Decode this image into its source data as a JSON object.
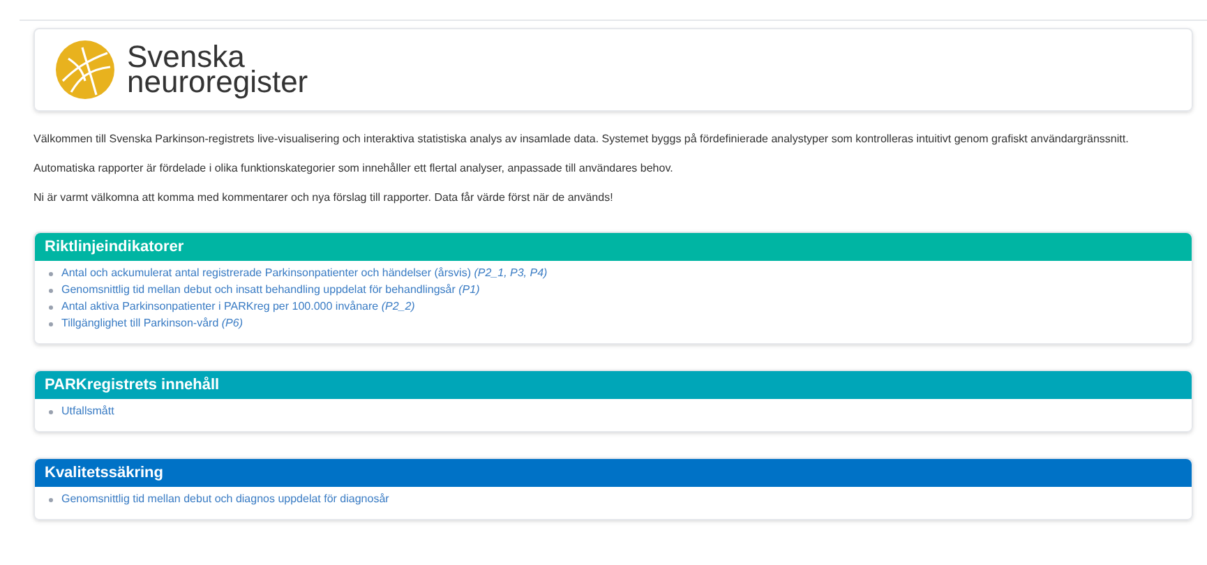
{
  "logo": {
    "line_1": "Svenska",
    "line_2": "neuroregister"
  },
  "intro": [
    "Välkommen till Svenska Parkinson-registrets live-visualisering och interaktiva statistiska analys av insamlade data. Systemet byggs på fördefinierade analystyper som kontrolleras intuitivt genom grafiskt användargränssnitt.",
    "Automatiska rapporter är fördelade i olika funktionskategorier som innehåller ett flertal analyser, anpassade till användares behov.",
    "Ni är varmt välkomna att komma med kommentarer och nya förslag till rapporter. Data får värde först när de används!"
  ],
  "panels": [
    {
      "title": "Riktlinjeindikatorer",
      "color": "#00b5a3",
      "items": [
        "Antal och ackumulerat antal registrerade Parkinsonpatienter och händelser (årsvis) *(P2_1, P3, P4)*",
        "Genomsnittlig tid mellan debut och insatt behandling uppdelat för behandlingsår *(P1)*",
        "Antal aktiva Parkinsonpatienter i PARKreg per 100.000 invånare *(P2_2)*",
        "Tillgänglighet till Parkinson-vård *(P6)*"
      ]
    },
    {
      "title": "PARKregistrets innehåll",
      "color": "#00a6b8",
      "items": [
        "Utfallsmått"
      ]
    },
    {
      "title": "Kvalitetssäkring",
      "color": "#0072c6",
      "items": [
        "Genomsnittlig tid mellan debut och diagnos uppdelat för diagnosår"
      ]
    }
  ]
}
